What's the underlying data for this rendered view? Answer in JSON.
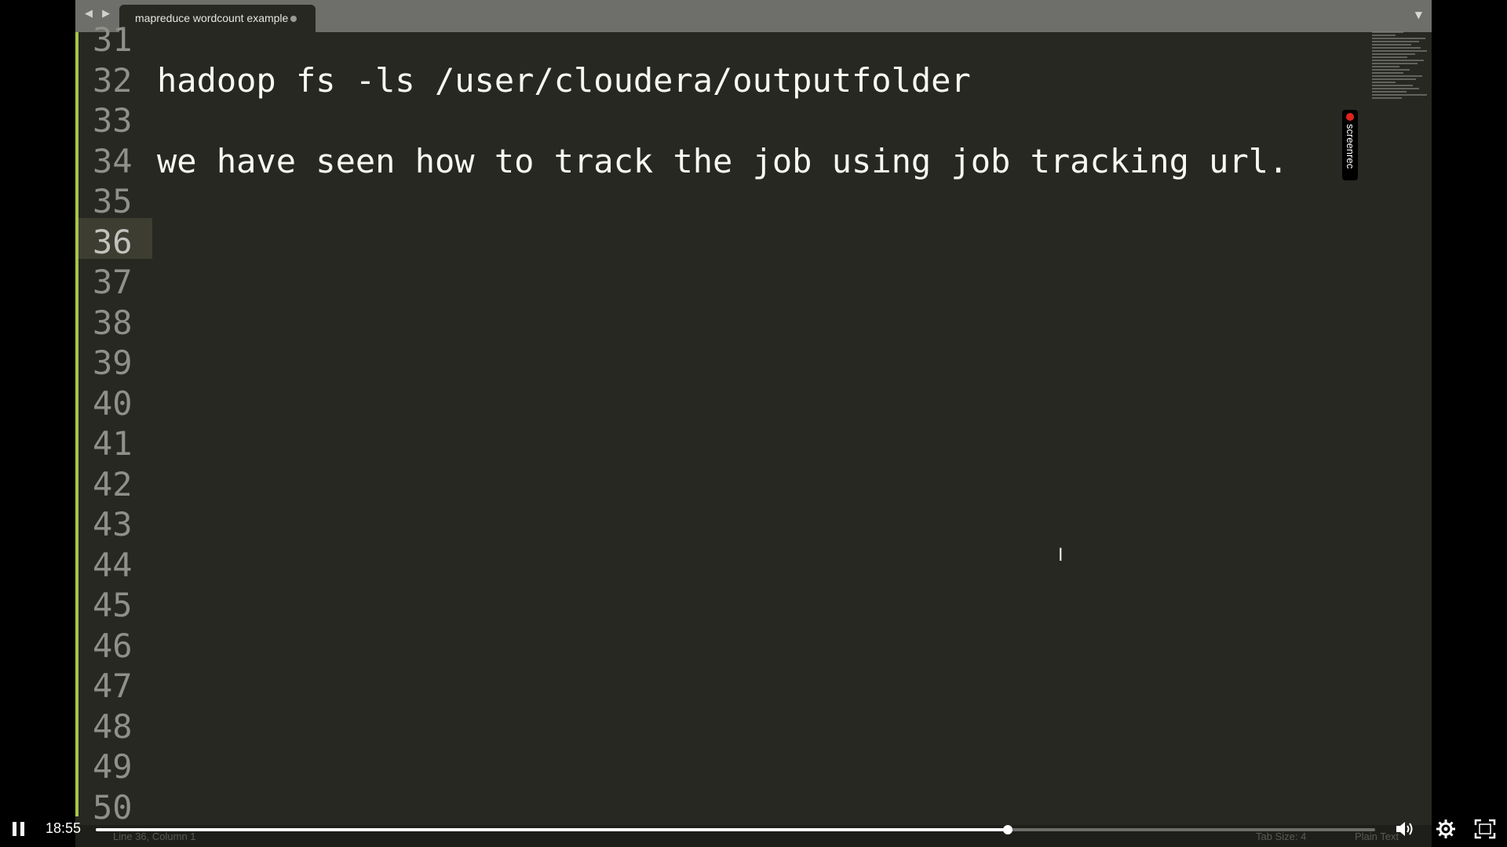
{
  "editor": {
    "nav_arrows": "◀ ▶",
    "tab_title": "mapreduce wordcount example",
    "tab_overflow": "▼",
    "lines": [
      {
        "number": "31",
        "text": ""
      },
      {
        "number": "32",
        "text": "hadoop fs -ls /user/cloudera/outputfolder"
      },
      {
        "number": "33",
        "text": ""
      },
      {
        "number": "34",
        "text": "we have seen how to track the job using job tracking url."
      },
      {
        "number": "35",
        "text": ""
      },
      {
        "number": "36",
        "text": ""
      },
      {
        "number": "37",
        "text": ""
      },
      {
        "number": "38",
        "text": ""
      },
      {
        "number": "39",
        "text": ""
      },
      {
        "number": "40",
        "text": ""
      },
      {
        "number": "41",
        "text": ""
      },
      {
        "number": "42",
        "text": ""
      },
      {
        "number": "43",
        "text": ""
      },
      {
        "number": "44",
        "text": ""
      },
      {
        "number": "45",
        "text": ""
      },
      {
        "number": "46",
        "text": ""
      },
      {
        "number": "47",
        "text": ""
      },
      {
        "number": "48",
        "text": ""
      },
      {
        "number": "49",
        "text": ""
      },
      {
        "number": "50",
        "text": ""
      }
    ],
    "current_line": "36"
  },
  "watermark": {
    "label": "screenrec"
  },
  "statusbar": {
    "position": "Line 36, Column 1",
    "tab_size": "Tab Size: 4",
    "syntax": "Plain Text"
  },
  "player": {
    "time": "18:55",
    "progress": 0.713
  },
  "colors": {
    "editor_bg": "#272822",
    "gutter_marker": "#a6c64a",
    "text": "#f8f8f2",
    "line_number": "#8f908a"
  }
}
